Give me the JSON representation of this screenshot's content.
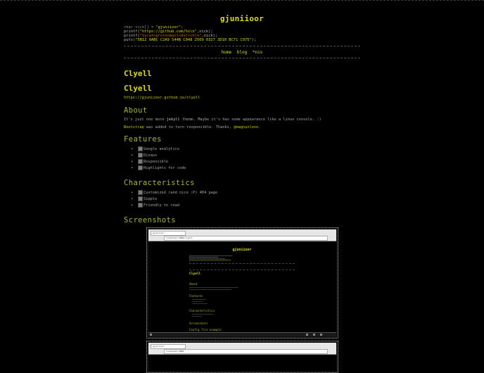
{
  "header": {
    "title": "gjuniioor",
    "code_lines": [
      {
        "pre": "char nick[] = ",
        "str": "\"gjuniioor\"",
        "post": ";"
      },
      {
        "pre": "printf(",
        "str": "\"https://github.com/%s\\n\"",
        "post": ",nick);"
      },
      {
        "pre": "printf(",
        "str": "\"%s<at>protonmail<dot>ch\\n\"",
        "post": ",nick);"
      },
      {
        "pre": "puts(",
        "str": "\"5B12 9ABC C2A9 544B C048 2509 0327 3D10 BC71 C975\"",
        "post": ");"
      }
    ]
  },
  "nav": {
    "items": [
      "home",
      "blog",
      "*nix"
    ]
  },
  "post": {
    "title": "Clyell",
    "subtitle": "Clyell",
    "repo_link": "https://gjuniioor.github.io/clyell",
    "about": {
      "heading": "About",
      "line1_pre": "It's just one more ",
      "line1_strong": "jekyll",
      "line1_post": " theme. Maybe it's has some appearance like a linux console. :)",
      "line2_link": "Bootstrap",
      "line2_post": " was added to turn responsible. Thanks, ",
      "line2_link2": "@magnunleno",
      "line2_end": "."
    },
    "features": {
      "heading": "Features",
      "items": [
        "Google analytics",
        "Disqus",
        "Responsible",
        "Highlights for code"
      ]
    },
    "characteristics": {
      "heading": "Characteristics",
      "items": [
        "Customized (and nice :P) 404 page",
        "Simple",
        "Friendly to read"
      ]
    },
    "screenshots": {
      "heading": "Screenshots",
      "shot1": {
        "tab": "gjuniioor",
        "url": "localhost:4000/clyell",
        "title": "gjuniioor",
        "post_title": "Clyell",
        "headings": [
          "About",
          "Features",
          "Characteristics",
          "Screenshots",
          "Config file example"
        ]
      },
      "shot2": {
        "tab": "gjuniioor",
        "url": "localhost:4000"
      }
    }
  },
  "colors": {
    "background": "#000000",
    "title_yellow": "#dede00",
    "section_green": "#a8b52c",
    "body_text": "#a8a8a8"
  }
}
